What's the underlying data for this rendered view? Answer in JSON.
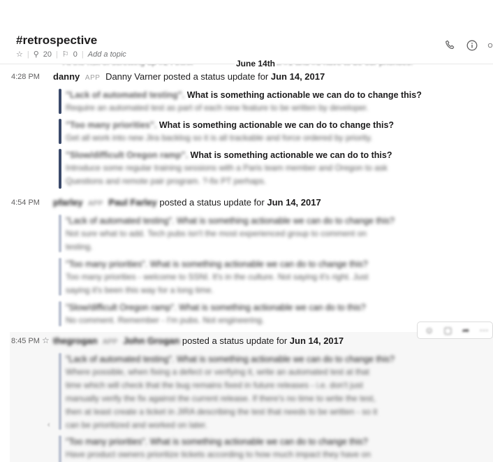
{
  "channel": {
    "name": "#retrospective",
    "members": "20",
    "pins": "0",
    "topic_placeholder": "Add a topic"
  },
  "header_icons": [
    "phone-icon",
    "info-icon",
    "gear-icon"
  ],
  "peek": {
    "text": "At the risk of screwing up #2 I think",
    "date": "June 14th",
    "trail": "that #1 and #3 have to be our priorities."
  },
  "messages": [
    {
      "time": "4:28 PM",
      "user": "danny",
      "badge": "APP",
      "full_name": "Danny Varner",
      "action": "posted a status update for",
      "date": "Jun 14, 2017",
      "attachments": [
        {
          "lead": "\"Lack of automated testing\".",
          "question": "What is something actionable we can do to change this?",
          "answer": [
            "Require an automated test as part of each new feature to be written by developer."
          ]
        },
        {
          "lead": "\"Too many priorities\".",
          "question": "What is something actionable we can do to change this?",
          "answer": [
            "Get all work into new Jira backlog so it is all trackable and force ordered by priority."
          ]
        },
        {
          "lead": "\"Slow/difficult Oregon ramp\".",
          "question": "What is something actionable we can do to this?",
          "answer": [
            "Introduce some regular training sessions with a Paris team member and Oregon to ask",
            "Questions and remote pair program. ?-fix PT perhaps."
          ]
        }
      ]
    },
    {
      "time": "4:54 PM",
      "user": "pfarley",
      "badge": "APP",
      "full_name": "Paul Farley",
      "action": "posted a status update for",
      "date": "Jun 14, 2017",
      "attachments": [
        {
          "question": "\"Lack of automated testing\". What is something actionable we can do to change this?",
          "answer": [
            "Not sure what to add. Tech pubs isn't the most experienced group to comment on",
            "testing."
          ]
        },
        {
          "question": "\"Too many priorities\". What is something actionable we can do to change this?",
          "answer": [
            "Too many priorities - welcome to SSNI. It's in the culture. Not saying it's right. Just",
            "saying it's been this way for a long time."
          ]
        },
        {
          "question": "\"Slow/difficult Oregon ramp\". What is something actionable we can do to this?",
          "answer": [
            "No comment. Remember - I'm pubs. Not engineering."
          ]
        }
      ]
    },
    {
      "time": "8:45 PM",
      "user": "thegrogan",
      "badge": "APP",
      "full_name": "John Grogan",
      "action": "posted a status update for",
      "date": "Jun 14, 2017",
      "attachments": [
        {
          "question": "\"Lack of automated testing\". What is something actionable we can do to change this?",
          "answer": [
            "Where possible, when fixing a defect or verifying it, write an automated test at that",
            "time which will check that the bug remains fixed in future releases - i.e. don't just",
            "manually verify the fix against the current release. If there's no time to write the test,",
            "then at least create a ticket in JIRA describing the test that needs to be written - so it",
            "can be prioritized and worked on later."
          ]
        },
        {
          "question": "\"Too many priorities\". What is something actionable we can do to change this?",
          "answer": [
            "Have product owners prioritize tickets according to how much impact they have on"
          ]
        }
      ]
    }
  ],
  "toolbar_icons": [
    "reaction-icon",
    "comment-icon",
    "share-icon",
    "more-icon"
  ]
}
